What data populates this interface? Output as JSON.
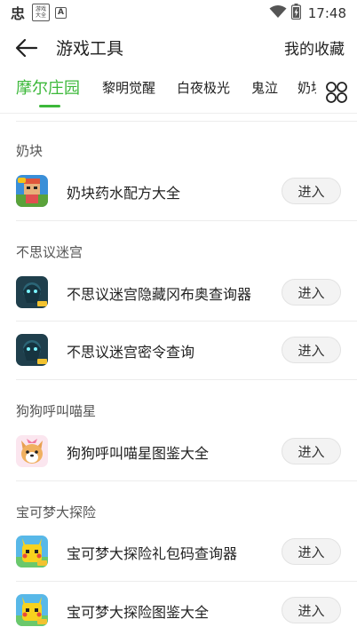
{
  "status_bar": {
    "app1_glyph": "忠",
    "app2_line1": "游戏",
    "app2_line2": "大全",
    "app3_glyph": "A",
    "time": "17:48",
    "icons": [
      "wifi-icon",
      "battery-icon"
    ]
  },
  "header": {
    "title": "游戏工具",
    "favorites_label": "我的收藏",
    "back_icon": "arrow-left-icon"
  },
  "tabs": {
    "items": [
      {
        "label": "摩尔庄园",
        "active": true
      },
      {
        "label": "黎明觉醒",
        "active": false
      },
      {
        "label": "白夜极光",
        "active": false
      },
      {
        "label": "鬼泣",
        "active": false
      },
      {
        "label": "奶块",
        "active": false
      }
    ],
    "grid_icon": "grid-menu-icon",
    "accent_color": "#3cb83a"
  },
  "sections": [
    {
      "title": "奶块",
      "items": [
        {
          "title": "奶块药水配方大全",
          "button": "进入",
          "icon": "naikuai-game-icon"
        }
      ]
    },
    {
      "title": "不思议迷宫",
      "items": [
        {
          "title": "不思议迷宫隐藏冈布奥查询器",
          "button": "进入",
          "icon": "busiyi-game-icon"
        },
        {
          "title": "不思议迷宫密令查询",
          "button": "进入",
          "icon": "busiyi-game-icon"
        }
      ]
    },
    {
      "title": "狗狗呼叫喵星",
      "items": [
        {
          "title": "狗狗呼叫喵星图鉴大全",
          "button": "进入",
          "icon": "dog-game-icon"
        }
      ]
    },
    {
      "title": "宝可梦大探险",
      "items": [
        {
          "title": "宝可梦大探险礼包码查询器",
          "button": "进入",
          "icon": "pokemon-game-icon"
        },
        {
          "title": "宝可梦大探险图鉴大全",
          "button": "进入",
          "icon": "pokemon-game-icon"
        }
      ]
    }
  ]
}
